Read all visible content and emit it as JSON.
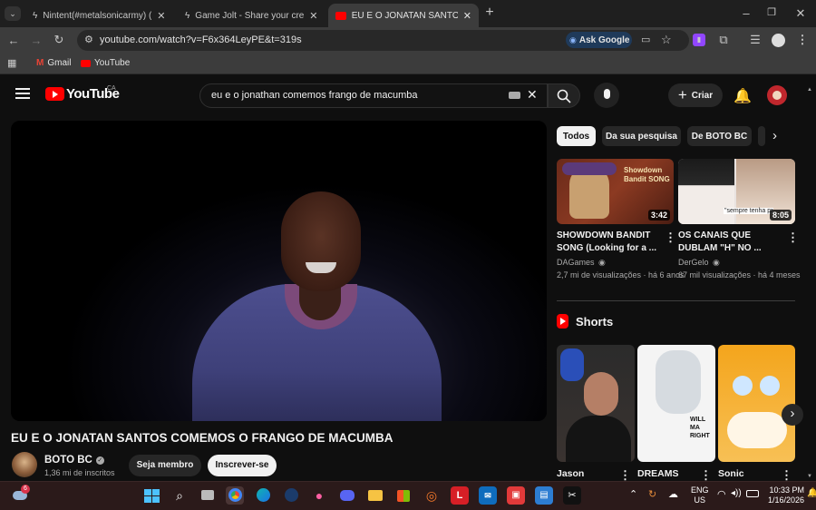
{
  "browser": {
    "tabs": [
      {
        "title": "Nintent(#metalsonicarmy) (@N",
        "active": false
      },
      {
        "title": "Game Jolt - Share your creation",
        "active": false
      },
      {
        "title": "EU E O JONATAN SANTOS COM",
        "active": true
      }
    ],
    "new_tab": "+",
    "url": "youtube.com/watch?v=F6x364LeyPE&t=319s",
    "ask_google": "Ask Google",
    "bookmarks": [
      "Gmail",
      "YouTube"
    ]
  },
  "youtube": {
    "logo_text": "YouTube",
    "country": "CA",
    "search_value": "eu e o jonathan comemos frango de macumba",
    "create_label": "Criar",
    "video_title": "EU E O JONATAN SANTOS COMEMOS O FRANGO DE MACUMBA",
    "channel": {
      "name": "BOTO BC",
      "subscribers": "1,36 mi de inscritos",
      "join_label": "Seja membro",
      "subscribe_label": "Inscrever-se"
    },
    "chips": [
      "Todos",
      "Da sua pesquisa",
      "De BOTO BC"
    ],
    "recommendations": [
      {
        "title_line1": "SHOWDOWN BANDIT",
        "title_line2": "SONG (Looking for a ...",
        "channel": "DAGames",
        "stats": "2,7 mi de visualizações · há 6 anos",
        "duration": "3:42",
        "thumb_text": "Showdown Bandit SONG"
      },
      {
        "title_line1": "OS CANAIS QUE",
        "title_line2": "DUBLAM \"H\" NO ...",
        "channel": "DerGelo",
        "stats": "67 mil visualizações · há 4 meses",
        "duration": "8:05",
        "thumb_text": "\"sempre tenha pr"
      }
    ],
    "shorts_label": "Shorts",
    "shorts": [
      {
        "title": "Jason"
      },
      {
        "title": "DREAMS",
        "thumb_text": "WILL MA RIGHT"
      },
      {
        "title": "Sonic"
      }
    ]
  },
  "taskbar": {
    "weather_badge": "6",
    "language": "ENG",
    "region": "US",
    "time": "10:33 PM",
    "date": "1/16/2026"
  }
}
